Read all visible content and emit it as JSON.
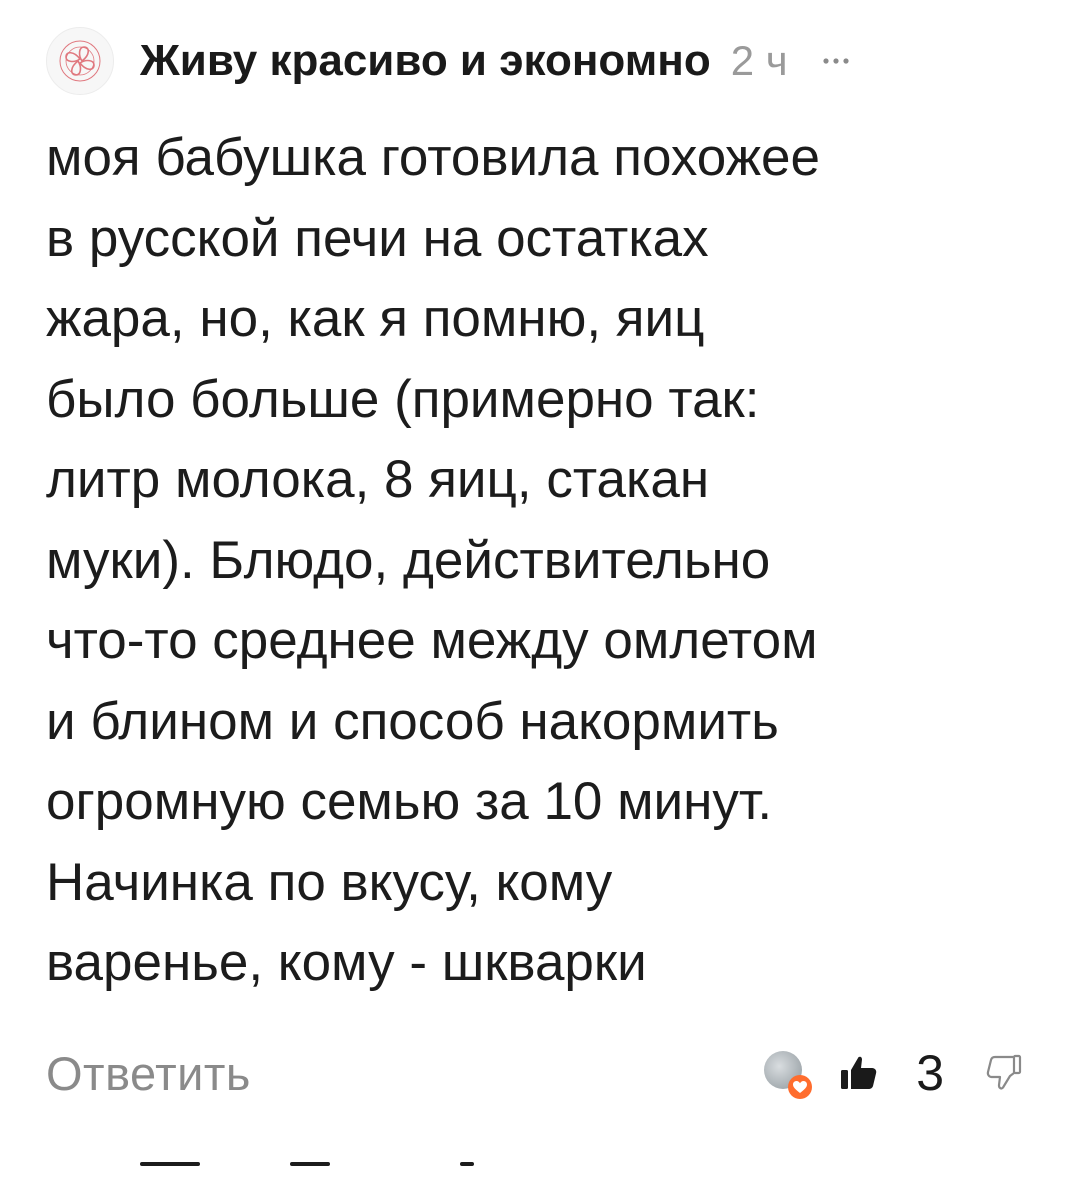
{
  "comment": {
    "author": "Живу красиво и экономно",
    "time": "2 ч",
    "avatar_icon": "four-heart-knot-icon",
    "more_icon": "more-dots-icon",
    "text": "моя бабушка готовила похожее\nв русской печи на остатках\nжара, но, как я помню, яиц\nбыло больше (примерно так:\nлитр молока, 8 яиц, стакан\nмуки). Блюдо, действительно\nчто-то среднее между омлетом\nи блином и способ накормить\nогромную семью за 10 минут.\nНачинка по вкусу, кому\nваренье, кому - шкварки",
    "reply_label": "Ответить",
    "likes_count": "3",
    "like_icon": "thumbs-up-icon",
    "dislike_icon": "thumbs-down-icon",
    "reaction_badge_icon": "heart-icon"
  },
  "colors": {
    "text": "#1c1c1c",
    "muted": "#8a8a8a",
    "time": "#9a9a9a",
    "avatar_logo": "#e0787f",
    "reaction_heart": "#ff6d2e"
  }
}
